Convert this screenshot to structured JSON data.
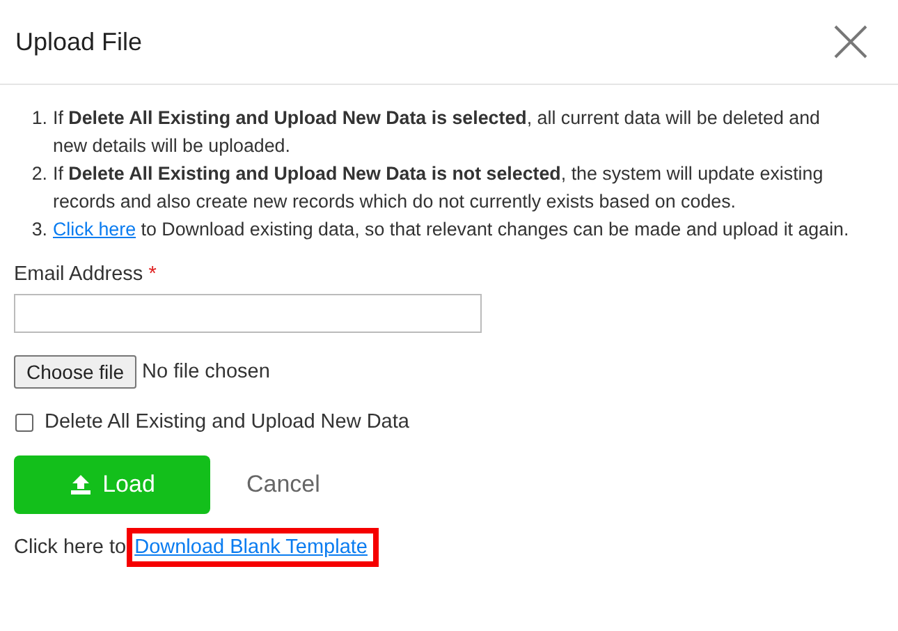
{
  "dialog": {
    "title": "Upload File"
  },
  "instructions": [
    {
      "number": "1.",
      "kind": "text",
      "text": "If **Delete All Existing and Upload New Data is selected**, all current data will be deleted and new details will be uploaded."
    },
    {
      "number": "2.",
      "kind": "text",
      "text": "If **Delete All Existing and Upload New Data is not selected**, the system will update existing records and also create new records which do not currently exists based on codes."
    },
    {
      "number": "3.",
      "kind": "link",
      "link": "Click here",
      "text": " to Download existing data, so that relevant changes can be made and upload it again."
    }
  ],
  "email": {
    "label": "Email Address",
    "required_mark": "*"
  },
  "file": {
    "button": "Choose file",
    "status": "No file chosen"
  },
  "delete_option": {
    "label": "Delete All Existing and Upload New Data",
    "checked": false
  },
  "buttons": {
    "load": "Load",
    "cancel": "Cancel"
  },
  "template": {
    "prefix": "Click here to",
    "link": "Download Blank Template",
    "highlighted": true
  }
}
